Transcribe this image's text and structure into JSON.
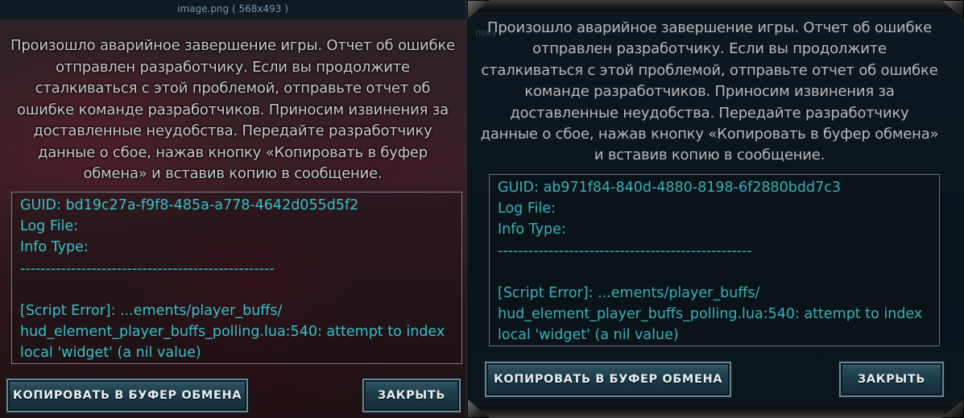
{
  "left": {
    "image_caption": "image.png ( 568x493 )",
    "message": "Произошло аварийное завершение игры. Отчет об ошибке отправлен разработчику. Если вы продолжите сталкиваться с этой проблемой, отправьте отчет об ошибке команде разработчиков. Приносим извинения за доставленные неудобства. Передайте разработчику данные о сбое, нажав кнопку «Копировать в буфер обмена» и вставив копию в сообщение.",
    "log_lines": [
      "GUID: bd19c27a-f9f8-485a-a778-4642d055d5f2",
      "Log File:",
      "Info Type:",
      "--------------------------------------------------",
      "",
      "[Script Error]: ...ements/player_buffs/",
      "hud_element_player_buffs_polling.lua:540: attempt to index",
      "local 'widget' (a nil value)"
    ],
    "copy_button": "КОПИРОВАТЬ В БУФЕР ОБМЕНА",
    "close_button": "ЗАКРЫТЬ"
  },
  "right": {
    "ghost_text": "поку",
    "message": "Произошло аварийное завершение игры. Отчет об ошибке отправлен разработчику. Если вы продолжите сталкиваться с этой проблемой, отправьте отчет об ошибке команде разработчиков. Приносим извинения за доставленные неудобства. Передайте разработчику данные о сбое, нажав кнопку «Копировать в буфер обмена» и вставив копию в сообщение.",
    "log_lines": [
      "GUID: ab971f84-840d-4880-8198-6f2880bdd7c3",
      "Log File:",
      "Info Type:",
      "--------------------------------------------------",
      "",
      "[Script Error]: ...ements/player_buffs/",
      "hud_element_player_buffs_polling.lua:540: attempt to index",
      "local 'widget' (a nil value)"
    ],
    "copy_button": "КОПИРОВАТЬ В БУФЕР ОБМЕНА",
    "close_button": "ЗАКРЫТЬ"
  },
  "colors": {
    "log_text": "#38c0c8",
    "body_text": "#c0c0c0",
    "button_fill": "#1e3d4a",
    "button_border": "#6c8592"
  }
}
